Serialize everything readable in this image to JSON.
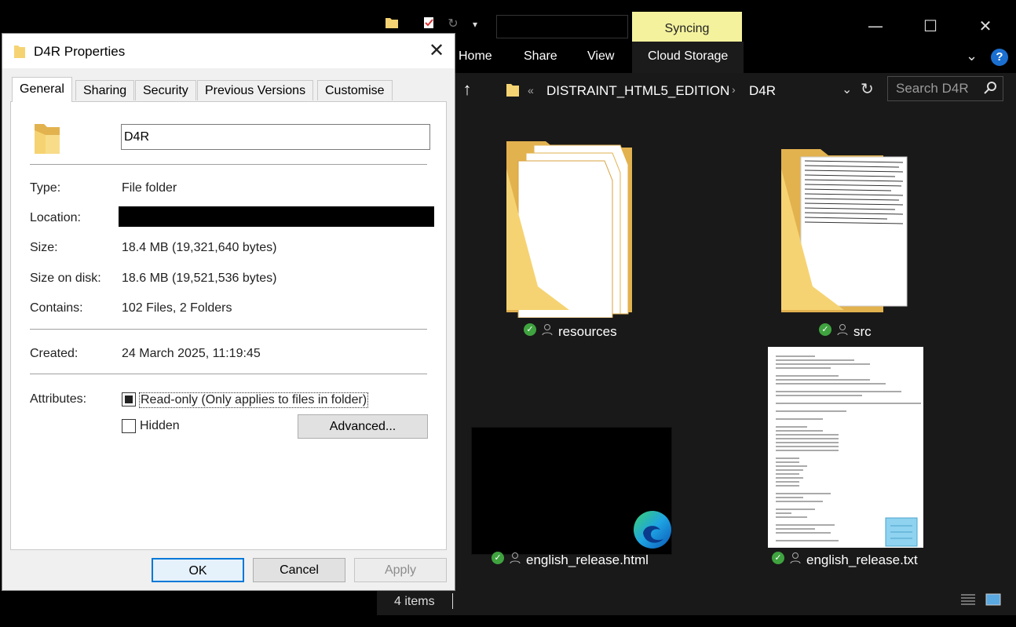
{
  "explorer": {
    "tabs": {
      "syncing": "Syncing"
    },
    "ribbon": {
      "home": "Home",
      "share": "Share",
      "view": "View",
      "cloud_storage": "Cloud Storage"
    },
    "breadcrumb": {
      "parent": "DISTRAINT_HTML5_EDITION",
      "current": "D4R"
    },
    "search_placeholder": "Search D4R",
    "items": [
      {
        "name": "resources",
        "type": "folder"
      },
      {
        "name": "src",
        "type": "folder"
      },
      {
        "name": "english_release.html",
        "type": "html"
      },
      {
        "name": "english_release.txt",
        "type": "text"
      }
    ],
    "status": "4 items",
    "colors": {
      "sync_ok": "#3fa33f",
      "folder": "#f6d372",
      "syncing_tab": "#f4f29d"
    }
  },
  "properties": {
    "title": "D4R Properties",
    "tabs": [
      "General",
      "Sharing",
      "Security",
      "Previous Versions",
      "Customise"
    ],
    "name_value": "D4R",
    "fields": {
      "type_label": "Type:",
      "type_value": "File folder",
      "location_label": "Location:",
      "size_label": "Size:",
      "size_value": "18.4 MB (19,321,640 bytes)",
      "size_on_disk_label": "Size on disk:",
      "size_on_disk_value": "18.6 MB (19,521,536 bytes)",
      "contains_label": "Contains:",
      "contains_value": "102 Files, 2 Folders",
      "created_label": "Created:",
      "created_value": "24 March 2025, 11:19:45",
      "attributes_label": "Attributes:"
    },
    "attributes": {
      "readonly": "Read-only (Only applies to files in folder)",
      "hidden": "Hidden"
    },
    "buttons": {
      "advanced": "Advanced...",
      "ok": "OK",
      "cancel": "Cancel",
      "apply": "Apply"
    }
  }
}
